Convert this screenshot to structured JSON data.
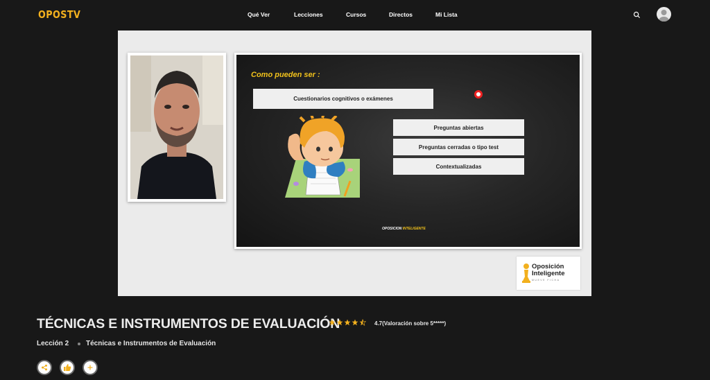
{
  "app": {
    "logo": "OPOSTV"
  },
  "nav": {
    "items": [
      "Qué Ver",
      "Lecciones",
      "Cursos",
      "Directos",
      "Mi Lista"
    ]
  },
  "icons": {
    "search": "search-icon",
    "avatar": "user-icon",
    "share": "share-icon",
    "rate": "thumbs-up-icon",
    "add": "plus-icon",
    "star": "star-icon"
  },
  "colors": {
    "brand": "#f2b01e",
    "background": "#181818",
    "slide_accent": "#f2c21b",
    "record": "#e22222"
  },
  "slide": {
    "title": "Como pueden ser :",
    "box_main": "Cuestionarios cognitivos o exámenes",
    "options": [
      "Preguntas abiertas",
      "Preguntas cerradas o tipo test",
      "Contextualizadas"
    ],
    "footer_prefix": "OPOSICION ",
    "footer_accent": "INTELIGENTE"
  },
  "brand": {
    "line1": "Oposición",
    "line2": "Inteligente",
    "tagline": "MUEVE FICHA"
  },
  "lesson": {
    "title": "TÉCNICAS E INSTRUMENTOS DE EVALUACIÓN",
    "rating": 4.7,
    "rating_text": "4.7(Valoración sobre 5*****)",
    "number_label": "Lección 2",
    "subtitle": "Técnicas e Instrumentos de Evaluación"
  }
}
